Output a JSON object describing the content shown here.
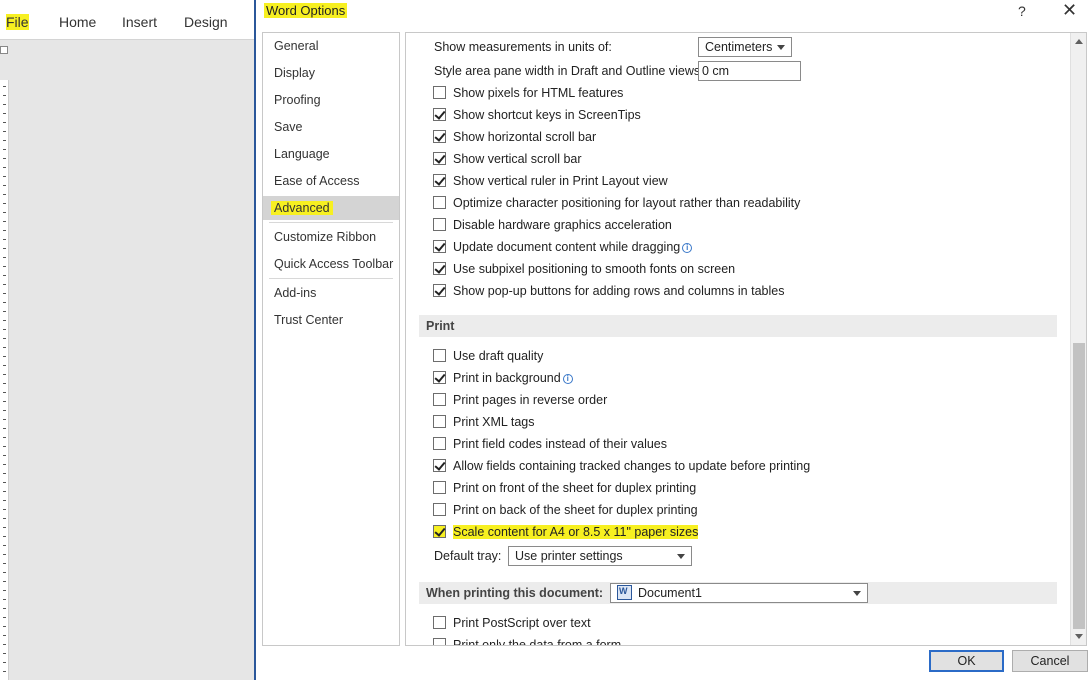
{
  "word": {
    "tabs": [
      "File",
      "Home",
      "Insert",
      "Design"
    ]
  },
  "dialog": {
    "title": "Word Options",
    "help": "?",
    "close": "✕",
    "nav": [
      "General",
      "Display",
      "Proofing",
      "Save",
      "Language",
      "Ease of Access",
      "Advanced",
      "Customize Ribbon",
      "Quick Access Toolbar",
      "Add-ins",
      "Trust Center"
    ],
    "selected_nav": "Advanced",
    "display": {
      "units_label": "Show measurements in units of:",
      "units_value": "Centimeters",
      "style_area_label": "Style area pane width in Draft and Outline views:",
      "style_area_value": "0 cm",
      "options": [
        {
          "label": "Show pixels for HTML features",
          "checked": false
        },
        {
          "label": "Show shortcut keys in ScreenTips",
          "checked": true
        },
        {
          "label": "Show horizontal scroll bar",
          "checked": true
        },
        {
          "label": "Show vertical scroll bar",
          "checked": true
        },
        {
          "label": "Show vertical ruler in Print Layout view",
          "checked": true
        },
        {
          "label": "Optimize character positioning for layout rather than readability",
          "checked": false
        },
        {
          "label": "Disable hardware graphics acceleration",
          "checked": false
        },
        {
          "label": "Update document content while dragging",
          "checked": true
        },
        {
          "label": "Use subpixel positioning to smooth fonts on screen",
          "checked": true
        },
        {
          "label": "Show pop-up buttons for adding rows and columns in tables",
          "checked": true
        }
      ]
    },
    "print": {
      "header": "Print",
      "options": [
        {
          "label": "Use draft quality",
          "checked": false
        },
        {
          "label": "Print in background",
          "checked": true
        },
        {
          "label": "Print pages in reverse order",
          "checked": false
        },
        {
          "label": "Print XML tags",
          "checked": false
        },
        {
          "label": "Print field codes instead of their values",
          "checked": false
        },
        {
          "label": "Allow fields containing tracked changes to update before printing",
          "checked": true
        },
        {
          "label": "Print on front of the sheet for duplex printing",
          "checked": false
        },
        {
          "label": "Print on back of the sheet for duplex printing",
          "checked": false
        },
        {
          "label": "Scale content for A4 or 8.5 x 11\" paper sizes",
          "checked": true
        }
      ],
      "default_tray_label": "Default tray:",
      "default_tray_value": "Use printer settings"
    },
    "when_printing": {
      "label": "When printing this document:",
      "document": "Document1",
      "options": [
        {
          "label": "Print PostScript over text",
          "checked": false
        },
        {
          "label": "Print only the data from a form",
          "checked": false
        }
      ]
    },
    "buttons": {
      "ok": "OK",
      "cancel": "Cancel"
    }
  },
  "colors": {
    "highlight": "#f7f021",
    "accent": "#2b579a"
  }
}
